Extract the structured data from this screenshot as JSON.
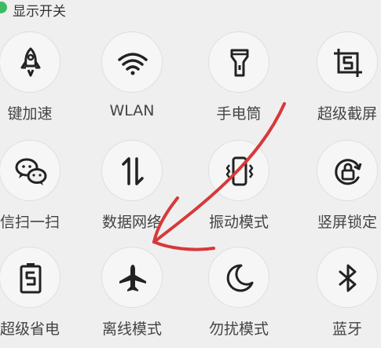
{
  "header": {
    "title": "显示开关",
    "dot_color": "#3dbb63"
  },
  "tiles": [
    {
      "label": "键加速",
      "icon": "rocket-icon"
    },
    {
      "label": "WLAN",
      "icon": "wifi-icon"
    },
    {
      "label": "手电筒",
      "icon": "flashlight-icon"
    },
    {
      "label": "超级截屏",
      "icon": "screenshot-icon"
    },
    {
      "label": "信扫一扫",
      "icon": "wechat-scan-icon"
    },
    {
      "label": "数据网络",
      "icon": "mobile-data-icon"
    },
    {
      "label": "振动模式",
      "icon": "vibrate-icon"
    },
    {
      "label": "竖屏锁定",
      "icon": "rotation-lock-icon"
    },
    {
      "label": "超级省电",
      "icon": "power-saving-icon"
    },
    {
      "label": "离线模式",
      "icon": "airplane-icon"
    },
    {
      "label": "勿扰模式",
      "icon": "moon-icon"
    },
    {
      "label": "蓝牙",
      "icon": "bluetooth-icon"
    }
  ],
  "annotation": {
    "color": "#d8383a"
  }
}
